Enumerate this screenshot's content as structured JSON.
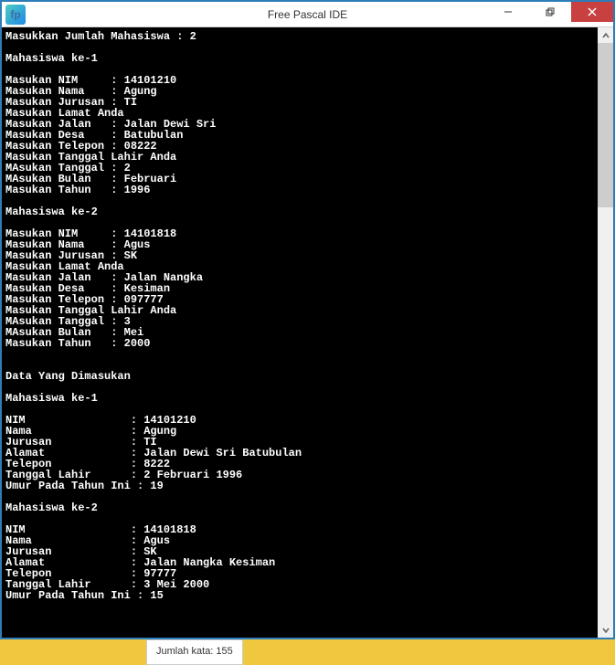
{
  "window": {
    "title": "Free Pascal IDE",
    "icon_label": "fp"
  },
  "controls": {
    "min": "minimize",
    "max": "maximize",
    "close": "close"
  },
  "console_lines": [
    "Masukkan Jumlah Mahasiswa : 2",
    "",
    "Mahasiswa ke-1",
    "",
    "Masukan NIM     : 14101210",
    "Masukan Nama    : Agung",
    "Masukan Jurusan : TI",
    "Masukan Lamat Anda",
    "Masukan Jalan   : Jalan Dewi Sri",
    "Masukan Desa    : Batubulan",
    "Masukan Telepon : 08222",
    "Masukan Tanggal Lahir Anda",
    "MAsukan Tanggal : 2",
    "MAsukan Bulan   : Februari",
    "Masukan Tahun   : 1996",
    "",
    "Mahasiswa ke-2",
    "",
    "Masukan NIM     : 14101818",
    "Masukan Nama    : Agus",
    "Masukan Jurusan : SK",
    "Masukan Lamat Anda",
    "Masukan Jalan   : Jalan Nangka",
    "Masukan Desa    : Kesiman",
    "Masukan Telepon : 097777",
    "Masukan Tanggal Lahir Anda",
    "MAsukan Tanggal : 3",
    "MAsukan Bulan   : Mei",
    "Masukan Tahun   : 2000",
    "",
    "",
    "Data Yang Dimasukan",
    "",
    "Mahasiswa ke-1",
    "",
    "NIM                : 14101210",
    "Nama               : Agung",
    "Jurusan            : TI",
    "Alamat             : Jalan Dewi Sri Batubulan",
    "Telepon            : 8222",
    "Tanggal Lahir      : 2 Februari 1996",
    "Umur Pada Tahun Ini : 19",
    "",
    "Mahasiswa ke-2",
    "",
    "NIM                : 14101818",
    "Nama               : Agus",
    "Jurusan            : SK",
    "Alamat             : Jalan Nangka Kesiman",
    "Telepon            : 97777",
    "Tanggal Lahir      : 3 Mei 2000",
    "Umur Pada Tahun Ini : 15"
  ],
  "status_bar": "Jumlah kata: 155"
}
